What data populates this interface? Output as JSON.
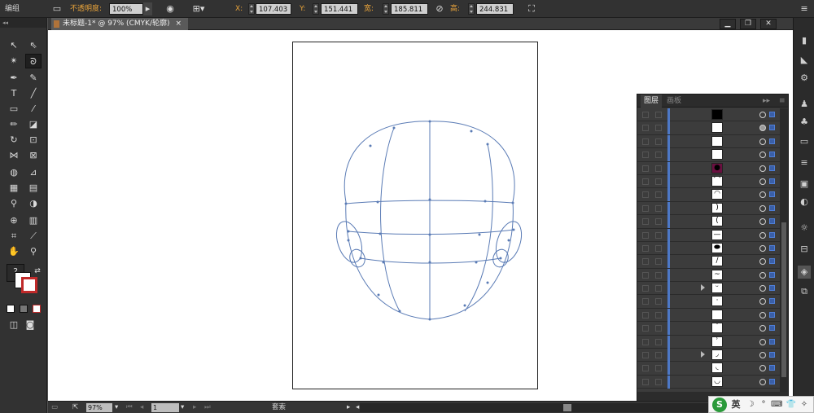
{
  "control_bar": {
    "group_label": "编组",
    "opacity_label": "不透明度:",
    "opacity_value": "100%",
    "x_label": "X:",
    "x_value": "107.403 m",
    "y_label": "Y:",
    "y_value": "151.441 m",
    "w_label": "宽:",
    "w_value": "185.811 m",
    "h_label": "高:",
    "h_value": "244.831 m",
    "collapse_glyph": "◂◂",
    "menu_glyph": "≡"
  },
  "document": {
    "tab_title": "未标题-1* @ 97% (CMYK/轮廓)",
    "tab_close": "×",
    "minimize": "▁",
    "restore": "❐",
    "close": "✕"
  },
  "status_bar": {
    "zoom_value": "97%",
    "artboard_value": "1",
    "mode_label": "套索"
  },
  "layers_panel": {
    "tab_layers": "图层",
    "tab_artboards": "画板",
    "expand_glyph": "▸▸",
    "menu_glyph": "≡",
    "rows": [
      {
        "thumb": "⬬",
        "arrow": false,
        "target_filled": false,
        "thumb_color": "#000000"
      },
      {
        "thumb": "",
        "arrow": false,
        "target_filled": true,
        "thumb_color": "#ffffff"
      },
      {
        "thumb": "",
        "arrow": false,
        "target_filled": false,
        "thumb_color": "#ffffff"
      },
      {
        "thumb": "",
        "arrow": false,
        "target_filled": false,
        "thumb_color": "#ffffff"
      },
      {
        "thumb": "●",
        "arrow": false,
        "target_filled": false,
        "thumb_color": "#6a1040"
      },
      {
        "thumb": "⌒",
        "arrow": false,
        "target_filled": false,
        "thumb_color": "#ffffff"
      },
      {
        "thumb": "◠",
        "arrow": false,
        "target_filled": false,
        "thumb_color": "#ffffff"
      },
      {
        "thumb": ")",
        "arrow": false,
        "target_filled": false,
        "thumb_color": "#ffffff"
      },
      {
        "thumb": "(",
        "arrow": false,
        "target_filled": false,
        "thumb_color": "#ffffff"
      },
      {
        "thumb": "—",
        "arrow": false,
        "target_filled": false,
        "thumb_color": "#ffffff"
      },
      {
        "thumb": "⬬",
        "arrow": false,
        "target_filled": false,
        "thumb_color": "#ffffff"
      },
      {
        "thumb": "∕",
        "arrow": false,
        "target_filled": false,
        "thumb_color": "#ffffff"
      },
      {
        "thumb": "~",
        "arrow": false,
        "target_filled": false,
        "thumb_color": "#ffffff"
      },
      {
        "thumb": "ᵕ",
        "arrow": true,
        "target_filled": false,
        "thumb_color": "#ffffff"
      },
      {
        "thumb": "·",
        "arrow": false,
        "target_filled": false,
        "thumb_color": "#ffffff"
      },
      {
        "thumb": "",
        "arrow": false,
        "target_filled": false,
        "thumb_color": "#ffffff"
      },
      {
        "thumb": "˙",
        "arrow": false,
        "target_filled": false,
        "thumb_color": "#ffffff"
      },
      {
        "thumb": "ʾ",
        "arrow": false,
        "target_filled": false,
        "thumb_color": "#ffffff"
      },
      {
        "thumb": "◞",
        "arrow": true,
        "target_filled": false,
        "thumb_color": "#ffffff"
      },
      {
        "thumb": "◟",
        "arrow": false,
        "target_filled": false,
        "thumb_color": "#ffffff"
      },
      {
        "thumb": "◡",
        "arrow": false,
        "target_filled": false,
        "thumb_color": "#ffffff"
      }
    ]
  },
  "ime": {
    "logo": "S",
    "lang": "英",
    "glyphs": [
      "☽",
      "°",
      "⌨",
      "👕",
      "✧"
    ]
  },
  "tools_icons": [
    "selection-tool",
    "direct-selection-tool",
    "magic-wand-tool",
    "lasso-tool",
    "pen-tool",
    "curvature-tool",
    "type-tool",
    "line-tool",
    "rectangle-tool",
    "paintbrush-tool",
    "pencil-tool",
    "eraser-tool",
    "rotate-tool",
    "scale-tool",
    "width-tool",
    "free-transform-tool",
    "shape-builder-tool",
    "perspective-tool",
    "mesh-tool",
    "gradient-tool",
    "eyedropper-tool",
    "blend-tool",
    "symbol-sprayer-tool",
    "column-graph-tool",
    "artboard-tool",
    "slice-tool",
    "hand-tool",
    "zoom-tool"
  ],
  "colors": {
    "accent_blue": "#4d78c6",
    "path_color": "#5a7bb5",
    "opacity_label": "#e8a33a"
  }
}
